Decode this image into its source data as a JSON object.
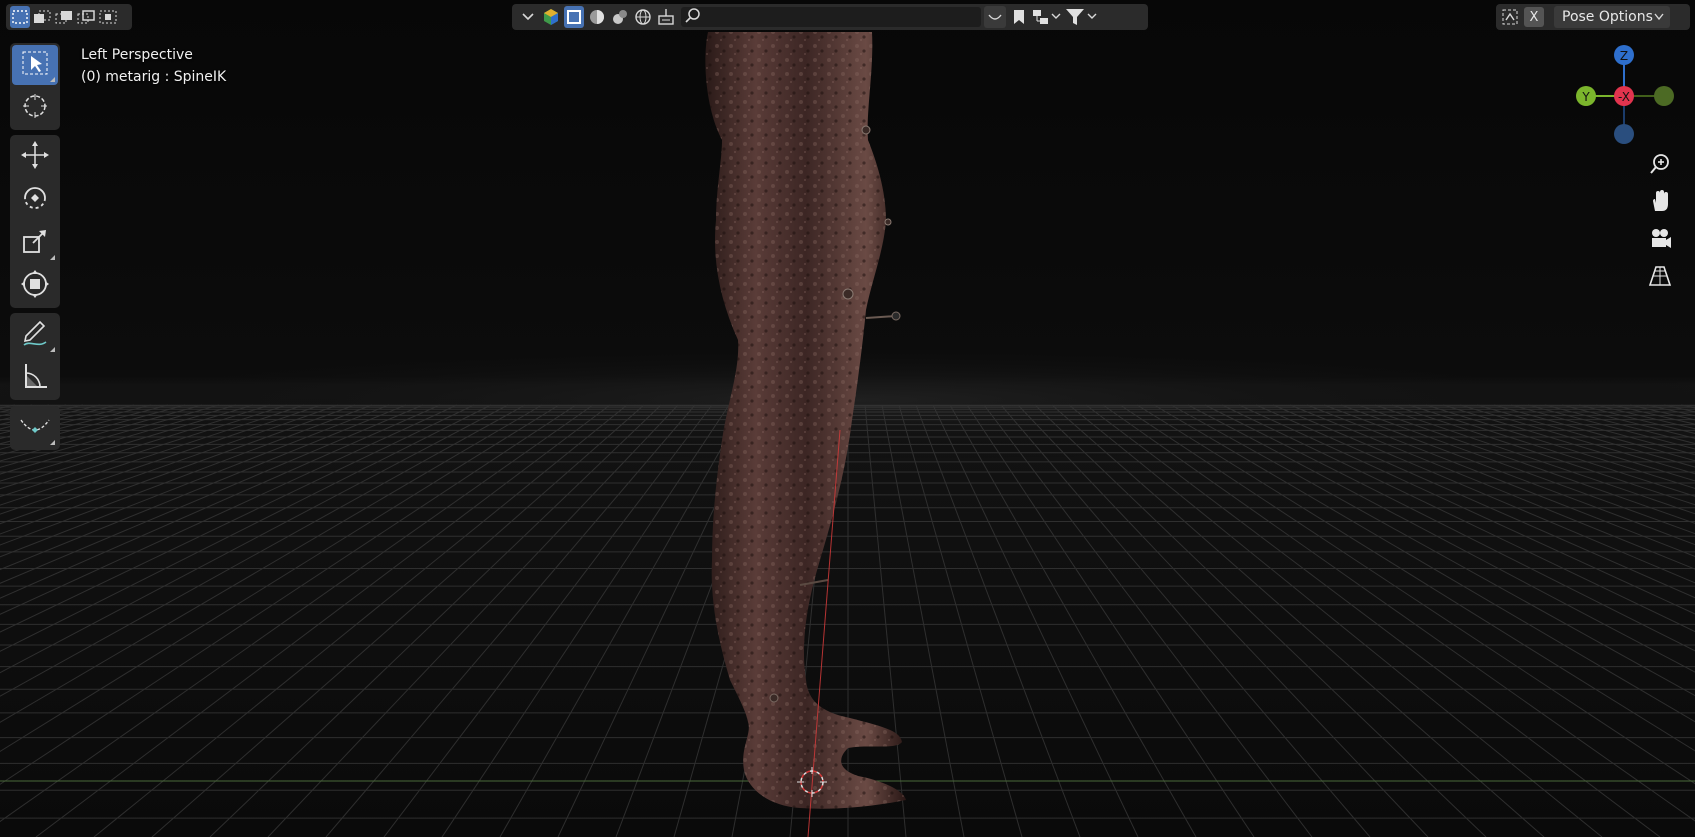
{
  "viewport": {
    "view_name": "Left Perspective",
    "context": "(0) metarig : SpineIK"
  },
  "header": {
    "select_modes": [
      {
        "icon": "select-set-icon",
        "active": true
      },
      {
        "icon": "select-extend-icon",
        "active": false
      },
      {
        "icon": "select-subtract-icon",
        "active": false
      },
      {
        "icon": "select-invert-icon",
        "active": false
      },
      {
        "icon": "select-intersect-icon",
        "active": false
      }
    ],
    "search": {
      "placeholder": ""
    },
    "close_label": "X",
    "pose_options_label": "Pose Options"
  },
  "toolbar": {
    "tools": [
      {
        "name": "select-box-tool",
        "icon": "cursor-select-icon",
        "active": true
      },
      {
        "name": "cursor-tool",
        "icon": "3d-cursor-icon",
        "active": false
      },
      {
        "name": "move-tool",
        "icon": "move-arrows-icon",
        "active": false
      },
      {
        "name": "rotate-tool",
        "icon": "rotate-icon",
        "active": false
      },
      {
        "name": "scale-tool",
        "icon": "scale-icon",
        "active": false
      },
      {
        "name": "transform-tool",
        "icon": "transform-icon",
        "active": false
      },
      {
        "name": "annotate-tool",
        "icon": "annotate-pencil-icon",
        "active": false
      },
      {
        "name": "measure-tool",
        "icon": "measure-ruler-icon",
        "active": false
      },
      {
        "name": "relax-pose-tool",
        "icon": "pose-curve-icon",
        "active": false
      }
    ]
  },
  "gizmo": {
    "axis_labels": {
      "z": "Z",
      "y": "Y",
      "x": "-X"
    },
    "colors": {
      "x": "#e2344e",
      "y": "#7bb52c",
      "z": "#2e6fcd"
    }
  },
  "nav_buttons": [
    "zoom-icon",
    "pan-hand-icon",
    "camera-view-icon",
    "perspective-grid-icon"
  ]
}
